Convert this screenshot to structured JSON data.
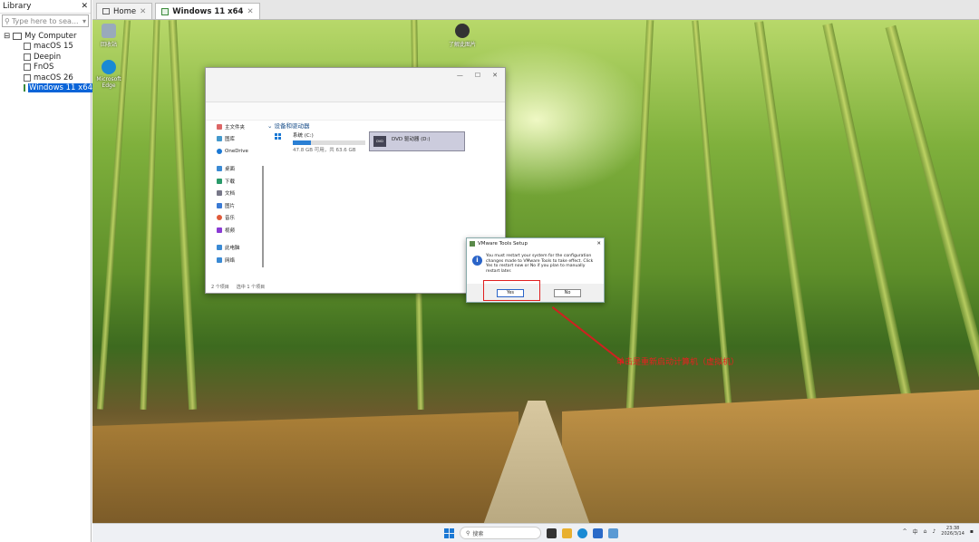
{
  "library": {
    "title": "Library",
    "close": "✕",
    "search_placeholder": "Type here to sea...",
    "root": "My Computer",
    "vms": [
      "macOS 15",
      "Deepin",
      "FnOS",
      "macOS 26",
      "Windows 11 x64"
    ],
    "selected": "Windows 11 x64"
  },
  "tabs": [
    {
      "label": "Home",
      "close": "✕"
    },
    {
      "label": "Windows 11 x64",
      "close": "✕"
    }
  ],
  "desktop_icons": [
    {
      "label": "回收站",
      "color": "#9ab"
    },
    {
      "label": "Microsoft Edge",
      "color": "#1a8ad4"
    },
    {
      "label": "了解此图片",
      "color": "#333"
    }
  ],
  "explorer": {
    "title_controls": [
      "—",
      "☐",
      "✕"
    ],
    "nav_items": [
      {
        "label": "主文件夹",
        "icon_color": "#d66"
      },
      {
        "label": "图库",
        "icon_color": "#49c"
      },
      {
        "label": "OneDrive",
        "icon_color": "#1a78d4"
      },
      {
        "label": "",
        "icon_color": ""
      },
      {
        "label": "桌面",
        "icon_color": "#3a8ad4"
      },
      {
        "label": "下载",
        "icon_color": "#2a9a6a"
      },
      {
        "label": "文档",
        "icon_color": "#778"
      },
      {
        "label": "图片",
        "icon_color": "#3a7ad4"
      },
      {
        "label": "音乐",
        "icon_color": "#e05a3a"
      },
      {
        "label": "视频",
        "icon_color": "#8a3ad4"
      },
      {
        "label": "",
        "icon_color": ""
      },
      {
        "label": "此电脑",
        "icon_color": "#3a8ad4"
      },
      {
        "label": "网络",
        "icon_color": "#3a8ad4"
      }
    ],
    "section_header": "设备和驱动器",
    "drive_c": {
      "name": "系统 (C:)",
      "space": "47.8 GB 可用，共 63.6 GB",
      "used_fraction": 0.25
    },
    "drive_d": {
      "name": "DVD 驱动器 (D:)",
      "tag": "DVD"
    },
    "status_items": "2 个项目",
    "status_selected": "选中 1 个项目"
  },
  "dialog": {
    "title": "VMware Tools Setup",
    "message": "You must restart your system for the configuration changes made to VMware Tools to take effect. Click Yes to restart now or No if you plan to manually restart later.",
    "yes": "Yes",
    "no": "No"
  },
  "annotation": "单击是重新启动计算机（虚拟机）",
  "taskbar": {
    "search_placeholder": "搜索",
    "tray_ime": "中",
    "time": "23:38",
    "date": "2026/3/14"
  }
}
